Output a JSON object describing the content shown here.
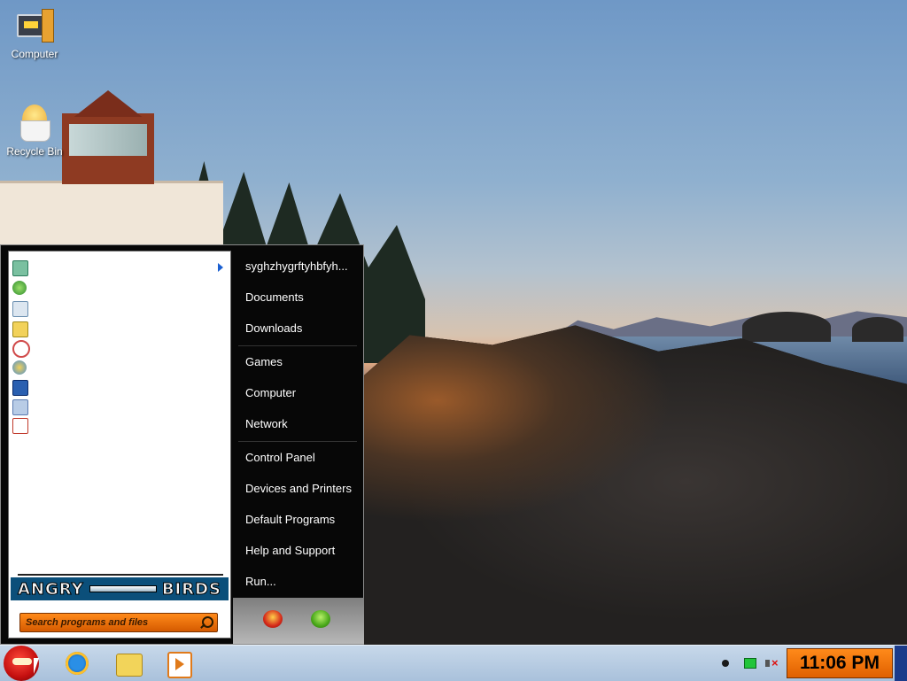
{
  "desktop": {
    "icons": [
      {
        "label": "Computer",
        "icon": "computer-icon"
      },
      {
        "label": "Recycle Bin",
        "icon": "recycle-bin-icon"
      }
    ]
  },
  "start_menu": {
    "pinned_programs": [
      {
        "icon": "getting-started-icon",
        "color": "#4caf50",
        "has_submenu": true
      },
      {
        "icon": "windows-media-center-icon",
        "color": "#2e8b2e"
      },
      {
        "icon": "calculator-icon",
        "color": "#6a8fb0"
      },
      {
        "icon": "sticky-notes-icon",
        "color": "#f2d25a"
      },
      {
        "icon": "snipping-tool-icon",
        "color": "#d04a4a"
      },
      {
        "icon": "paint-icon",
        "color": "#4a8fd0"
      },
      {
        "icon": "remote-desktop-icon",
        "color": "#2a5fb0"
      },
      {
        "icon": "magnifier-icon",
        "color": "#5a7ab0"
      },
      {
        "icon": "solitaire-icon",
        "color": "#c0392b"
      }
    ],
    "banner": {
      "left": "ANGRY",
      "right": "BIRDS"
    },
    "search": {
      "placeholder": "Search programs and files"
    },
    "right_items": [
      {
        "label": "syghzhygrftyhbfyh..."
      },
      {
        "label": "Documents"
      },
      {
        "label": "Downloads"
      },
      {
        "label": "Games"
      },
      {
        "label": "Computer"
      },
      {
        "label": "Network"
      },
      {
        "label": "Control Panel"
      },
      {
        "label": "Devices and Printers"
      },
      {
        "label": "Default Programs"
      },
      {
        "label": "Help and Support"
      },
      {
        "label": "Run..."
      }
    ],
    "power_buttons": [
      {
        "icon": "shutdown-red-bird-icon"
      },
      {
        "icon": "options-green-pig-icon"
      }
    ]
  },
  "taskbar": {
    "pinned": [
      {
        "icon": "internet-explorer-icon"
      },
      {
        "icon": "windows-explorer-icon"
      },
      {
        "icon": "media-player-icon"
      }
    ],
    "tray": {
      "icons": [
        "tray-notification-icon",
        "network-icon",
        "volume-muted-icon"
      ]
    },
    "clock": "11:06 PM",
    "accent": "#ff8a1a"
  }
}
